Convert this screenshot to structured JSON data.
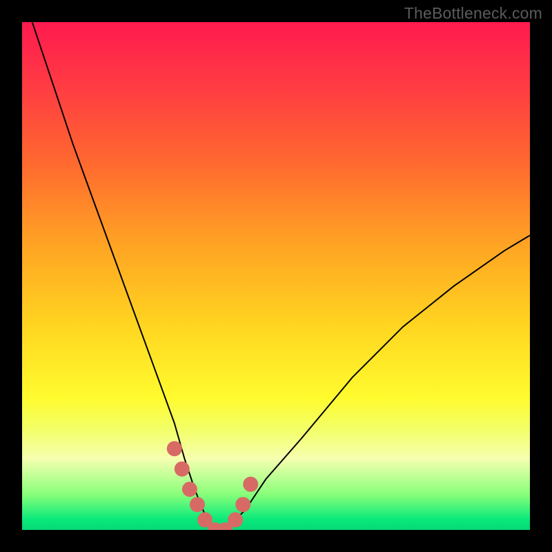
{
  "attribution": "TheBottleneck.com",
  "chart_data": {
    "type": "line",
    "title": "",
    "xlabel": "",
    "ylabel": "",
    "xlim": [
      0,
      100
    ],
    "ylim": [
      0,
      100
    ],
    "grid": false,
    "series": [
      {
        "name": "bottleneck-curve",
        "color": "#000000",
        "x": [
          2,
          6,
          10,
          14,
          18,
          22,
          26,
          30,
          32,
          34,
          36,
          38,
          40,
          44,
          48,
          55,
          65,
          75,
          85,
          95,
          100
        ],
        "values": [
          100,
          88,
          76,
          65,
          54,
          43,
          32,
          21,
          14,
          8,
          3,
          0,
          0,
          4,
          10,
          18,
          30,
          40,
          48,
          55,
          58
        ]
      },
      {
        "name": "highlight-dots",
        "color": "#d86a66",
        "x": [
          30,
          31.5,
          33,
          34.5,
          36,
          38,
          40,
          42,
          43.5,
          45
        ],
        "values": [
          16,
          12,
          8,
          5,
          2,
          0,
          0,
          2,
          5,
          9
        ]
      }
    ],
    "gradient_stops": [
      {
        "pos": 0,
        "color": "#ff1a4f"
      },
      {
        "pos": 14,
        "color": "#ff3f41"
      },
      {
        "pos": 28,
        "color": "#ff6a2f"
      },
      {
        "pos": 44,
        "color": "#ffa423"
      },
      {
        "pos": 60,
        "color": "#ffd620"
      },
      {
        "pos": 74,
        "color": "#fffb2e"
      },
      {
        "pos": 80,
        "color": "#f3ff66"
      },
      {
        "pos": 86,
        "color": "#f6ffb0"
      },
      {
        "pos": 93,
        "color": "#88ff7a"
      },
      {
        "pos": 98,
        "color": "#08e97a"
      },
      {
        "pos": 100,
        "color": "#07d878"
      }
    ]
  }
}
